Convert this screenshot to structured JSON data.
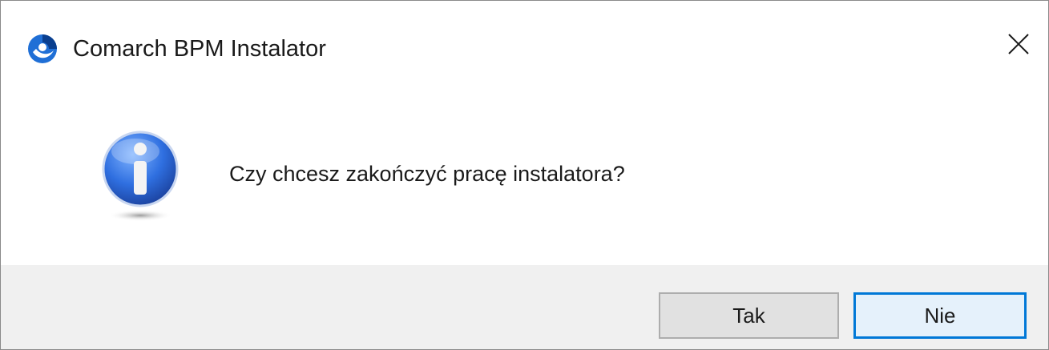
{
  "window": {
    "title": "Comarch BPM Instalator",
    "app_icon": "comarch-logo-icon",
    "close_icon": "close-icon"
  },
  "dialog": {
    "icon": "information-icon",
    "message": "Czy chcesz zakończyć pracę instalatora?"
  },
  "buttons": {
    "yes_label": "Tak",
    "no_label": "Nie",
    "default": "Nie"
  },
  "colors": {
    "focus_border": "#0078d7",
    "footer_bg": "#f0f0f0",
    "logo_blue": "#1f6fd6"
  }
}
